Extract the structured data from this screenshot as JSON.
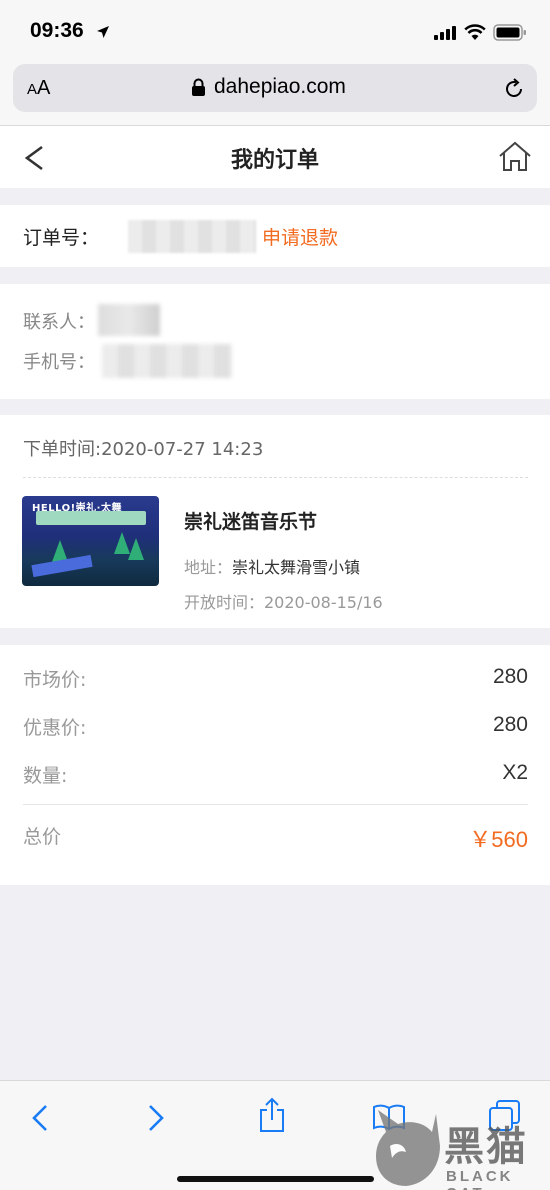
{
  "status_bar": {
    "time": "09:36"
  },
  "browser": {
    "aa_label_small": "A",
    "aa_label_large": "A",
    "url": "dahepiao.com"
  },
  "header": {
    "title": "我的订单"
  },
  "order": {
    "label": "订单号：",
    "refund_label": "申请退款"
  },
  "contact": {
    "name_label": "联系人：",
    "phone_label": "手机号："
  },
  "product": {
    "order_time": "下单时间:2020-07-27 14:23",
    "poster_text": "HELLO!崇礼·太舞",
    "name": "崇礼迷笛音乐节",
    "address_label": "地址：",
    "address": "崇礼太舞滑雪小镇",
    "open_time": "开放时间：2020-08-15/16"
  },
  "prices": {
    "market_label": "市场价:",
    "market_value": "280",
    "discount_label": "优惠价:",
    "discount_value": "280",
    "qty_label": "数量:",
    "qty_value": "X2",
    "total_label": "总价",
    "total_value": "￥560"
  },
  "colors": {
    "accent": "#f26b21",
    "ios_blue": "#1a7cf5"
  },
  "watermark": {
    "cn": "黑猫",
    "en": "BLACK CAT"
  }
}
